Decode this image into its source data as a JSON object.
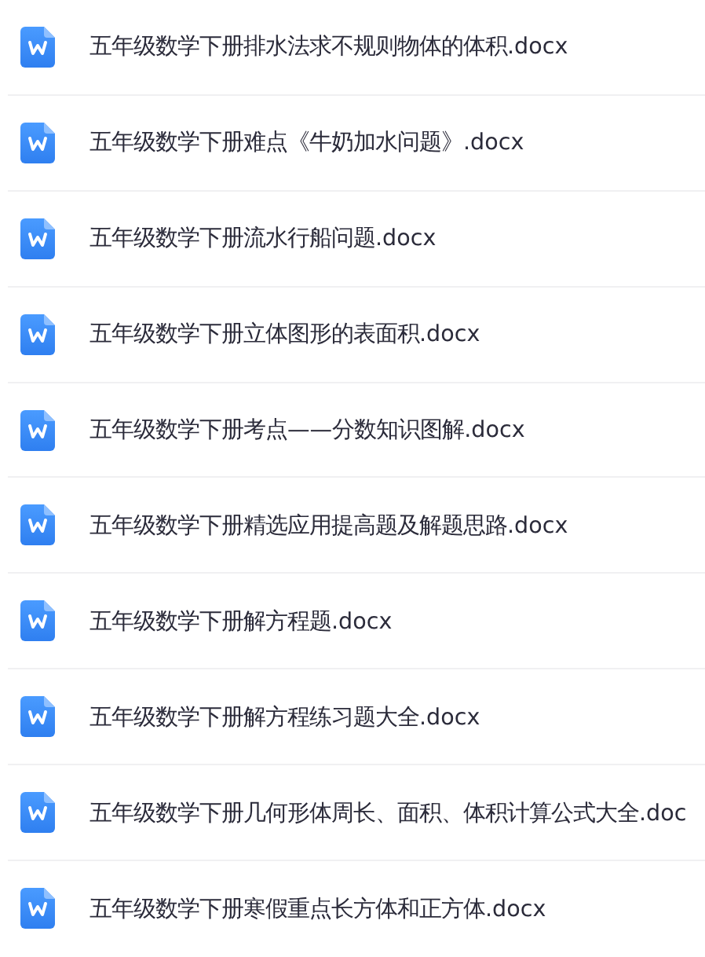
{
  "files": [
    {
      "name": "五年级数学下册排水法求不规则物体的体积.docx"
    },
    {
      "name": "五年级数学下册难点《牛奶加水问题》.docx"
    },
    {
      "name": "五年级数学下册流水行船问题.docx"
    },
    {
      "name": "五年级数学下册立体图形的表面积.docx"
    },
    {
      "name": "五年级数学下册考点——分数知识图解.docx"
    },
    {
      "name": "五年级数学下册精选应用提高题及解题思路.docx"
    },
    {
      "name": "五年级数学下册解方程题.docx"
    },
    {
      "name": "五年级数学下册解方程练习题大全.docx"
    },
    {
      "name": "五年级数学下册几何形体周长、面积、体积计算公式大全.doc"
    },
    {
      "name": "五年级数学下册寒假重点长方体和正方体.docx"
    }
  ]
}
